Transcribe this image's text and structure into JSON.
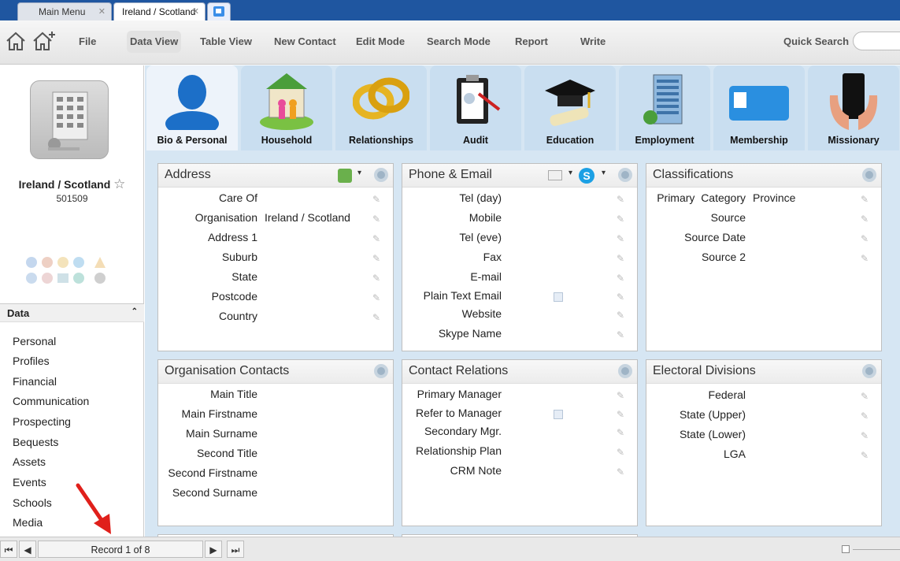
{
  "window_tabs": [
    {
      "label": "Main Menu"
    },
    {
      "label": "Ireland / Scotland"
    }
  ],
  "toolbar": {
    "items": [
      "File",
      "Data View",
      "Table View",
      "New Contact",
      "Edit Mode",
      "Search Mode",
      "Report",
      "Write"
    ],
    "quick_search_label": "Quick Search"
  },
  "record": {
    "name": "Ireland / Scotland",
    "id": "501509"
  },
  "sidebar": {
    "section": "Data",
    "items": [
      "Personal",
      "Profiles",
      "Financial",
      "Communication",
      "Prospecting",
      "Bequests",
      "Assets",
      "Events",
      "Schools",
      "Media"
    ]
  },
  "categories": [
    "Bio & Personal",
    "Household",
    "Relationships",
    "Audit",
    "Education",
    "Employment",
    "Membership",
    "Missionary"
  ],
  "panels": {
    "address": {
      "title": "Address",
      "fields": [
        {
          "label": "Care Of",
          "value": ""
        },
        {
          "label": "Organisation",
          "value": "Ireland / Scotland"
        },
        {
          "label": "Address 1",
          "value": ""
        },
        {
          "label": "Suburb",
          "value": ""
        },
        {
          "label": "State",
          "value": ""
        },
        {
          "label": "Postcode",
          "value": ""
        },
        {
          "label": "Country",
          "value": ""
        }
      ]
    },
    "phone": {
      "title": "Phone & Email",
      "fields": [
        "Tel (day)",
        "Mobile",
        "Tel (eve)",
        "Fax",
        "E-mail",
        "Plain Text Email",
        "Website",
        "Skype Name"
      ]
    },
    "classifications": {
      "title": "Classifications",
      "fields": [
        {
          "label": "Primary  Category",
          "value": "Province"
        },
        {
          "label": "Source",
          "value": ""
        },
        {
          "label": "Source Date",
          "value": ""
        },
        {
          "label": "Source 2",
          "value": ""
        }
      ]
    },
    "org_contacts": {
      "title": "Organisation Contacts",
      "fields": [
        "Main Title",
        "Main Firstname",
        "Main Surname",
        "Second Title",
        "Second Firstname",
        "Second Surname"
      ]
    },
    "contact_relations": {
      "title": "Contact Relations",
      "fields": [
        "Primary Manager",
        "Refer to Manager",
        "Secondary Mgr.",
        "Relationship Plan",
        "CRM Note"
      ]
    },
    "electoral": {
      "title": "Electoral Divisions",
      "fields": [
        "Federal",
        "State (Upper)",
        "State (Lower)",
        "LGA"
      ]
    }
  },
  "status": {
    "record_count": "Record 1 of 8"
  },
  "colors": {
    "tabstrip": "#1f56a0",
    "main_bg": "#d6e6f3",
    "arrow": "#e0201b"
  }
}
